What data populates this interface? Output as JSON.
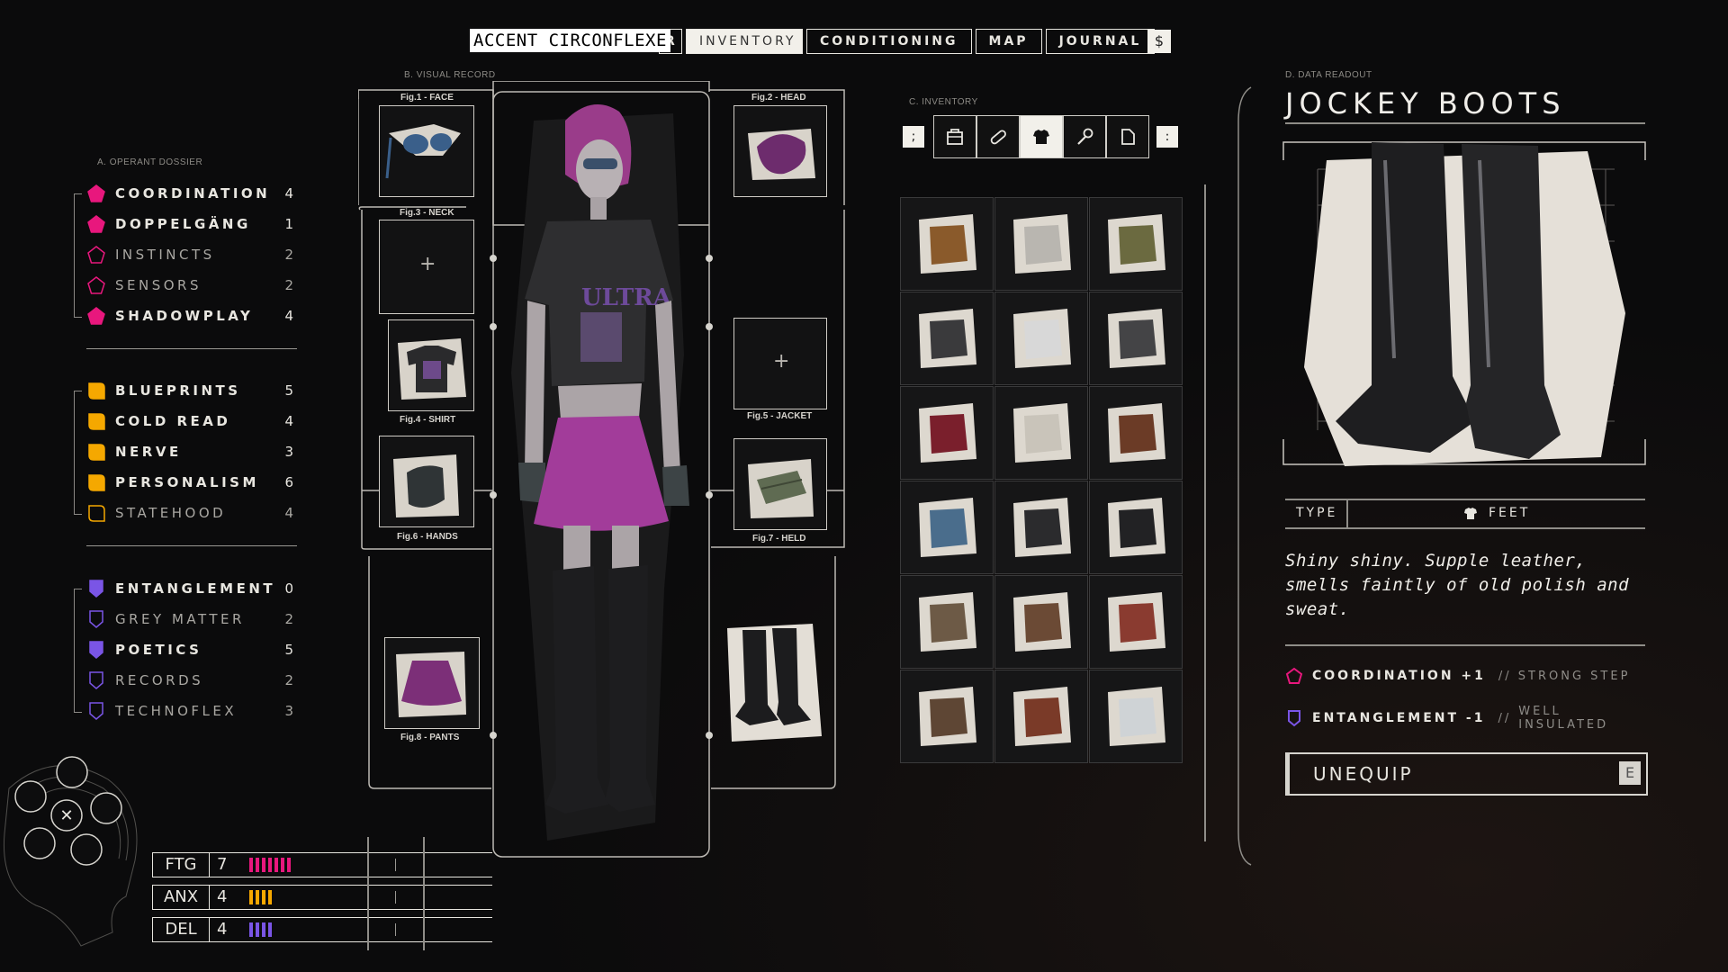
{
  "nav": {
    "accent_tag": "ACCENT CIRCONFLEXE",
    "tabs": [
      {
        "label": "R"
      },
      {
        "label": "INVENTORY"
      },
      {
        "label": "CONDITIONING"
      },
      {
        "label": "MAP"
      },
      {
        "label": "JOURNAL"
      }
    ],
    "currency_icon": "$"
  },
  "dossier": {
    "heading": "A. OPERANT DOSSIER",
    "groups": [
      {
        "color": "#e8177d",
        "shape": "pentagon",
        "stats": [
          {
            "label": "COORDINATION",
            "value": "4",
            "filled": true
          },
          {
            "label": "DOPPELGÄNG",
            "value": "1",
            "filled": true
          },
          {
            "label": "INSTINCTS",
            "value": "2",
            "filled": false
          },
          {
            "label": "SENSORS",
            "value": "2",
            "filled": false
          },
          {
            "label": "SHADOWPLAY",
            "value": "4",
            "filled": true
          }
        ]
      },
      {
        "color": "#f5a800",
        "shape": "rounded-square",
        "stats": [
          {
            "label": "BLUEPRINTS",
            "value": "5",
            "filled": true
          },
          {
            "label": "COLD READ",
            "value": "4",
            "filled": true
          },
          {
            "label": "NERVE",
            "value": "3",
            "filled": true
          },
          {
            "label": "PERSONALISM",
            "value": "6",
            "filled": true
          },
          {
            "label": "STATEHOOD",
            "value": "4",
            "filled": false
          }
        ]
      },
      {
        "color": "#7a55e6",
        "shape": "shield",
        "stats": [
          {
            "label": "ENTANGLEMENT",
            "value": "0",
            "filled": true
          },
          {
            "label": "GREY MATTER",
            "value": "2",
            "filled": false
          },
          {
            "label": "POETICS",
            "value": "5",
            "filled": true
          },
          {
            "label": "RECORDS",
            "value": "2",
            "filled": false
          },
          {
            "label": "TECHNOFLEX",
            "value": "3",
            "filled": false
          }
        ]
      }
    ]
  },
  "conditions": [
    {
      "code": "FTG",
      "value": "7",
      "color": "#e8177d",
      "pips": 7
    },
    {
      "code": "ANX",
      "value": "4",
      "color": "#f5a800",
      "pips": 4
    },
    {
      "code": "DEL",
      "value": "4",
      "color": "#7a55e6",
      "pips": 4
    }
  ],
  "visual_record": {
    "heading": "B. VISUAL RECORD",
    "slots": {
      "face": "Fig.1 - FACE",
      "head": "Fig.2 - HEAD",
      "neck": "Fig.3 - NECK",
      "shirt": "Fig.4 - SHIRT",
      "jacket": "Fig.5 - JACKET",
      "hands": "Fig.6 - HANDS",
      "held": "Fig.7 - HELD",
      "pants": "Fig.8 - PANTS"
    },
    "shirt_print": "ULTRA"
  },
  "inventory": {
    "heading": "C. INVENTORY",
    "left_key": ";",
    "right_key": ":",
    "filters": [
      "bag-icon",
      "bandage-icon",
      "shirt-icon",
      "tool-icon",
      "document-icon"
    ],
    "active_filter": 2,
    "items": [
      {
        "name": "brown-jacket",
        "color": "#8a5a2b"
      },
      {
        "name": "grey-tank-top",
        "color": "#b9b6b0"
      },
      {
        "name": "olive-loafer",
        "color": "#6b6a40"
      },
      {
        "name": "black-gloves",
        "color": "#3a3a3c"
      },
      {
        "name": "white-sneakers",
        "color": "#d8d8d8"
      },
      {
        "name": "dark-trousers",
        "color": "#444446"
      },
      {
        "name": "red-shorts",
        "color": "#7a1f2c"
      },
      {
        "name": "bead-necklace",
        "color": "#c9c4ba"
      },
      {
        "name": "leather-coat",
        "color": "#6b3b26"
      },
      {
        "name": "blue-helmet",
        "color": "#4a6d8c"
      },
      {
        "name": "black-cap",
        "color": "#2b2b2d"
      },
      {
        "name": "black-glasses",
        "color": "#222224"
      },
      {
        "name": "knee-pads",
        "color": "#6d5a46"
      },
      {
        "name": "brown-jacket-2",
        "color": "#6b4a35"
      },
      {
        "name": "red-boots",
        "color": "#8a3b30"
      },
      {
        "name": "brown-skirt",
        "color": "#5e4634"
      },
      {
        "name": "ankle-boots",
        "color": "#7a3a28"
      },
      {
        "name": "white-cap",
        "color": "#cfd3d6"
      }
    ]
  },
  "readout": {
    "heading": "D. DATA READOUT",
    "title": "JOCKEY BOOTS",
    "type_label": "TYPE",
    "type_value": "FEET",
    "description": "Shiny shiny. Supple leather, smells faintly of old polish and sweat.",
    "modifiers": [
      {
        "name": "COORDINATION +1",
        "note": "// STRONG STEP",
        "color": "#e8177d",
        "shape": "pentagon"
      },
      {
        "name": "ENTANGLEMENT -1",
        "note": "// WELL INSULATED",
        "note_line1": "WELL",
        "note_line2": "INSULATED",
        "color": "#7a55e6",
        "shape": "shield"
      }
    ],
    "action_label": "UNEQUIP",
    "action_key": "E"
  }
}
